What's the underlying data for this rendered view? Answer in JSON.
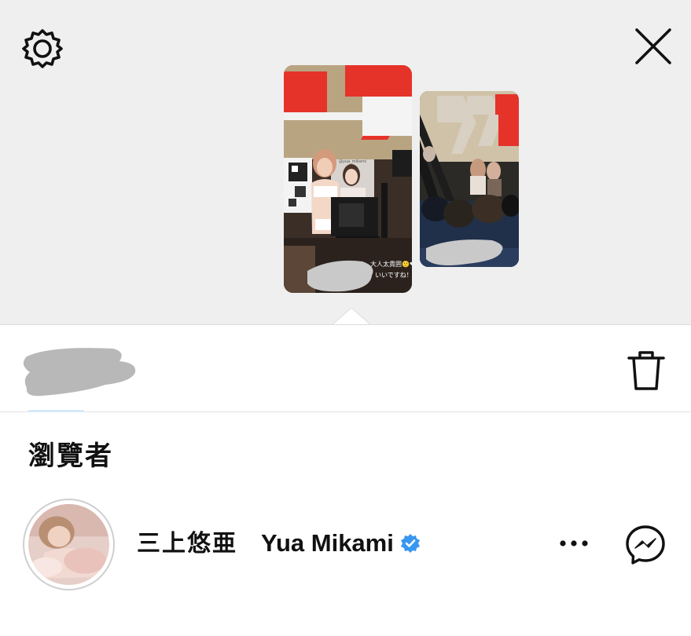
{
  "header": {
    "settings_icon": "gear-icon",
    "close_icon": "close-icon"
  },
  "stories": [
    {
      "overlay_line_1": "大人太貴囲🙂❤",
      "overlay_line_2": "いいですね！",
      "sticker_text": "@yua_mikami"
    },
    {
      "overlay_line_1": ""
    }
  ],
  "owner": {
    "name_redacted": true,
    "delete_icon": "trash-icon"
  },
  "viewers_section": {
    "title": "瀏覽者"
  },
  "viewers": [
    {
      "username": "三上悠亜",
      "full_name": "Yua Mikami",
      "verified": true,
      "more_icon": "more-dots-icon",
      "message_icon": "messenger-icon"
    }
  ],
  "colors": {
    "top_background": "#efefef",
    "verified_blue": "#3897f0",
    "story_red": "#e5332a"
  }
}
